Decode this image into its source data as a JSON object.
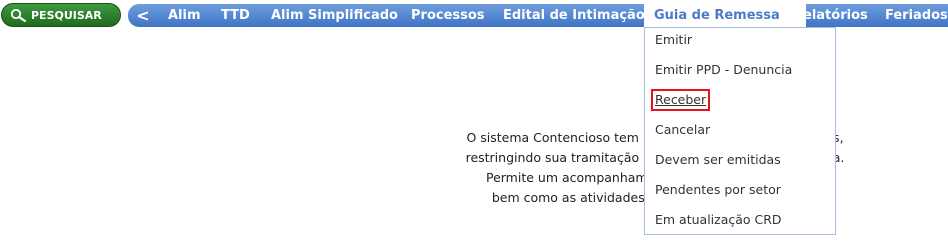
{
  "search": {
    "label": "PESQUISAR",
    "icon": "magnifier-icon"
  },
  "nav": {
    "back_label": "<",
    "items": [
      {
        "label": "Alim"
      },
      {
        "label": "TTD"
      },
      {
        "label": "Alim Simplificado"
      },
      {
        "label": "Processos"
      },
      {
        "label": "Edital de Intimação"
      },
      {
        "label": "Guia de Remessa",
        "active": true
      },
      {
        "label": "Relatórios"
      },
      {
        "label": "Feriados"
      }
    ]
  },
  "dropdown": {
    "items": [
      {
        "label": "Emitir"
      },
      {
        "label": "Emitir PPD - Denuncia"
      },
      {
        "label": "Receber",
        "highlighted": true
      },
      {
        "label": "Cancelar"
      },
      {
        "label": "Devem ser emitidas"
      },
      {
        "label": "Pendentes por setor"
      },
      {
        "label": "Em atualização CRD"
      }
    ]
  },
  "body": {
    "lines": [
      "O sistema Contencioso tem por finalidade ... ões tributárias,",
      "restringindo sua tramitação inadequada ... guia de remessa.",
      "Permite um acompanhamento do pro... sua conclusão",
      "bem como as atividades que foram ... epartamento."
    ]
  },
  "colors": {
    "nav_gradient_top": "#6f9ede",
    "nav_gradient_bottom": "#3f74c6",
    "search_green": "#2e7d2e",
    "highlight_red": "#e0141e"
  }
}
